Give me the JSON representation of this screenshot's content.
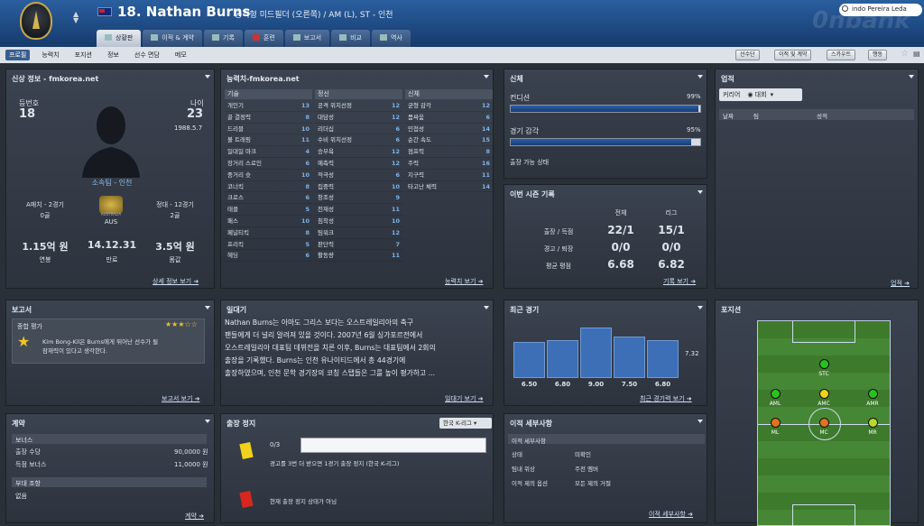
{
  "header": {
    "name": "18. Nathan Burns",
    "info": "공격형 미드필더 (오른쪽) / AM (L), ST - 인천",
    "search": "indo Pereira Leda",
    "watermark": "0nbank",
    "updown": "▲\n▼"
  },
  "tabs": [
    "상황판",
    "이적 & 계약",
    "기록",
    "훈련",
    "보고서",
    "비교",
    "역사"
  ],
  "subtabs": [
    "프로필",
    "능력치",
    "포지션",
    "정보",
    "선수 면담",
    "메모"
  ],
  "subbuttons": [
    "선수단",
    "이적 및 계약",
    "스카우트",
    "행동"
  ],
  "profile": {
    "title": "신상 정보 - fmkorea.net",
    "num_label": "등번호",
    "num": "18",
    "age_label": "나이",
    "age": "23",
    "dob": "1988.5.7",
    "club": "소속팀 - 인천",
    "a_caps": "A매치 - 2경기",
    "a_goals": "0골",
    "nat": "AUS",
    "flag_text": "AUSTRALIA",
    "reg_caps": "정대 - 12경기",
    "reg_goals": "2골",
    "wage": "1.15억 원",
    "wage_l": "연봉",
    "expiry": "14.12.31",
    "expiry_l": "만료",
    "value": "3.5억 원",
    "value_l": "몸값",
    "more": "상세 정보 보기"
  },
  "attrs": {
    "title": "능력치-fmkorea.net",
    "more": "능력치 보기",
    "tech_h": "기술",
    "tech": [
      [
        "개인기",
        "13"
      ],
      [
        "골 결정력",
        "8"
      ],
      [
        "드리블",
        "10"
      ],
      [
        "볼 트래핑",
        "11"
      ],
      [
        "일대일 마크",
        "4"
      ],
      [
        "장거리 스로인",
        "6"
      ],
      [
        "중거리 슛",
        "10"
      ],
      [
        "코너킥",
        "8"
      ],
      [
        "크로스",
        "6"
      ],
      [
        "태클",
        "5"
      ],
      [
        "패스",
        "10"
      ],
      [
        "페널티킥",
        "8"
      ],
      [
        "프리킥",
        "5"
      ],
      [
        "헤딩",
        "6"
      ]
    ],
    "mental_h": "정신",
    "mental": [
      [
        "공격 위치선정",
        "12"
      ],
      [
        "대담성",
        "12"
      ],
      [
        "리더십",
        "6"
      ],
      [
        "수비 위치선정",
        "6"
      ],
      [
        "승부욕",
        "12"
      ],
      [
        "예측력",
        "12"
      ],
      [
        "적극성",
        "6"
      ],
      [
        "집중력",
        "10"
      ],
      [
        "창조성",
        "9"
      ],
      [
        "천재성",
        "11"
      ],
      [
        "침착성",
        "10"
      ],
      [
        "팀워크",
        "12"
      ],
      [
        "판단력",
        "7"
      ],
      [
        "활동량",
        "11"
      ]
    ],
    "phys_h": "신체",
    "phys": [
      [
        "균형 감각",
        "12"
      ],
      [
        "몸싸움",
        "6"
      ],
      [
        "민첩성",
        "14"
      ],
      [
        "순간 속도",
        "15"
      ],
      [
        "점프력",
        "8"
      ],
      [
        "주력",
        "16"
      ],
      [
        "지구력",
        "11"
      ],
      [
        "타고난 체력",
        "14"
      ]
    ]
  },
  "physical": {
    "title": "신체",
    "cond_l": "컨디션",
    "cond": "99%",
    "cond_v": 0.99,
    "sharp_l": "경기 감각",
    "sharp": "95%",
    "sharp_v": 0.95,
    "status": "출장 가능 상태"
  },
  "season": {
    "title": "이번 시즌 기록",
    "col1": "전체",
    "col2": "리그",
    "r1": "출장 / 득점",
    "r1a": "22/1",
    "r1b": "15/1",
    "r2": "경고 / 퇴장",
    "r2a": "0/0",
    "r2b": "0/0",
    "r3": "평균 평점",
    "r3a": "6.68",
    "r3b": "6.82",
    "more": "기록 보기"
  },
  "achieve": {
    "title": "업적",
    "btn": "커리어",
    "dd": "대회",
    "c1": "날짜",
    "c2": "팀",
    "c3": "성적",
    "more": "업적"
  },
  "report": {
    "title": "보고서",
    "sub": "종합 평가",
    "stars": "★★★☆☆",
    "text1": "Kim Bong-Kil은 Burns에게 뛰어난 선수가 될",
    "text2": "잠재력이 있다고 생각한다.",
    "more": "보고서 보기"
  },
  "diary": {
    "title": "일대기",
    "lines": [
      "Nathan Burns는 아마도 그리스 보다는 오스트레일리아의 축구",
      "팬들에게 더 널리 알려져 있을 것이다. 2007년 6월 싱가포르전에서",
      "오스트레일리아 대표팀 데뷔전을 치른 이후, Burns는 대표팀에서 2회의",
      "출장을 기록했다. Burns는 인천 유나이티드에서 총 44경기에",
      "출장하였으며, 인천 문학 경기장의 코칭 스탭들은 그를 높이 평가하고 ..."
    ],
    "more": "일대기 보기"
  },
  "recent": {
    "title": "최근 경기",
    "avg": "7.32",
    "more": "최근 경기력 보기"
  },
  "chart_data": {
    "type": "bar",
    "categories": [
      "6.50",
      "6.80",
      "9.00",
      "7.50",
      "6.80"
    ],
    "values": [
      6.5,
      6.8,
      9.0,
      7.5,
      6.8
    ],
    "ylim": [
      0,
      10
    ]
  },
  "position": {
    "title": "포지션",
    "labels": [
      "STC",
      "AML",
      "AMC",
      "AMR",
      "ML",
      "MC",
      "MR"
    ]
  },
  "contract": {
    "title": "계약",
    "bonus_h": "보너스",
    "b1": "출장 수당",
    "b1v": "90,0000 원",
    "b2": "득점 보너스",
    "b2v": "11,0000 원",
    "clause_h": "부대 조항",
    "clause": "없음",
    "more": "계약"
  },
  "ban": {
    "title": "출장 정지",
    "dd": "한국 K-리그",
    "yellow_count": "0/3",
    "yellow_text": "경고를 3번 더 받으면 1경기 출장 정지 (한국 K-리그)",
    "red_text": "현재 출장 정지 상태가 아님"
  },
  "transfer": {
    "title": "이적 세부사항",
    "sub": "이적 세부사항",
    "r1": "상태",
    "r1v": "미확인",
    "r2": "팀내 위상",
    "r2v": "주전 멤버",
    "r3": "이적 제의 옵션",
    "r3v": "모든 제의 거절",
    "more": "이적 세부사항"
  },
  "colors": {
    "accent": "#3d6fb7",
    "header": "#1f4b85",
    "yellow": "#f2d21a",
    "red": "#d8261e"
  }
}
